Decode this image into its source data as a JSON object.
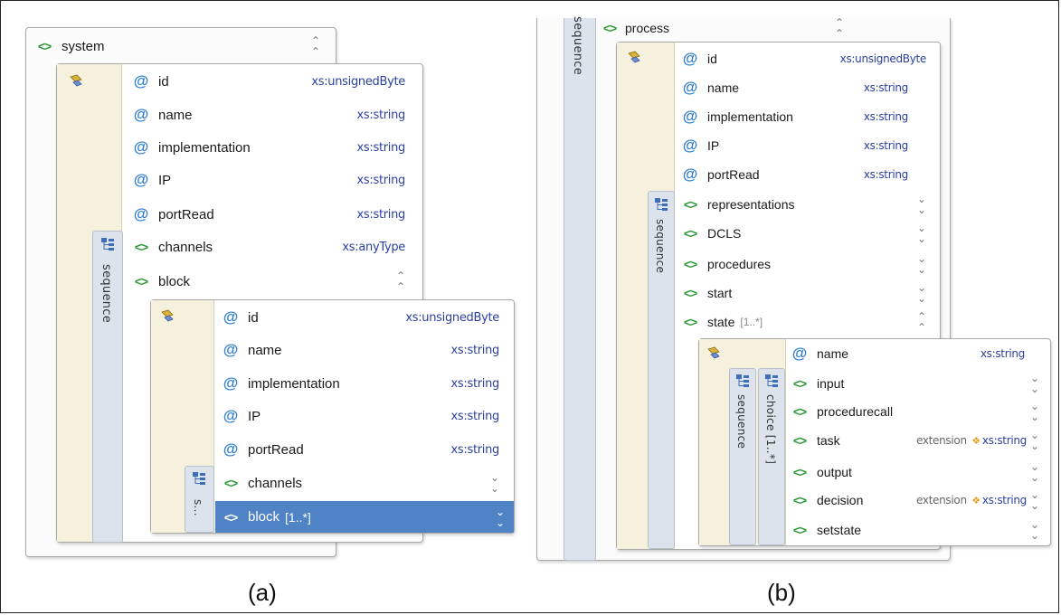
{
  "captions": {
    "a": "(a)",
    "b": "(b)"
  },
  "colors": {
    "attribute_icon": "#2f7fd6",
    "element_icon": "#2f9a3a",
    "type_text": "#2b3fa0",
    "selection": "#5083c6",
    "attributes_box": "#f5f1dd",
    "sequence_bar": "#dde3ec"
  },
  "icons": {
    "attribute": "@",
    "element": "<>",
    "collapse": "⌃⌃",
    "expand": "⌄⌄",
    "extension": "plus-diamond-icon",
    "sequence": "sequence-icon",
    "attributes": "attributes-icon"
  },
  "a": {
    "system": {
      "name": "system",
      "sequence_label": "sequence",
      "attributes": [
        {
          "name": "id",
          "type": "xs:unsignedByte"
        },
        {
          "name": "name",
          "type": "xs:string"
        },
        {
          "name": "implementation",
          "type": "xs:string"
        },
        {
          "name": "IP",
          "type": "xs:string"
        },
        {
          "name": "portRead",
          "type": "xs:string"
        }
      ],
      "elements": [
        {
          "name": "channels",
          "type": "xs:anyType"
        },
        {
          "name": "block"
        }
      ]
    },
    "block": {
      "sequence_label": "s...",
      "attributes": [
        {
          "name": "id",
          "type": "xs:unsignedByte"
        },
        {
          "name": "name",
          "type": "xs:string"
        },
        {
          "name": "implementation",
          "type": "xs:string"
        },
        {
          "name": "IP",
          "type": "xs:string"
        },
        {
          "name": "portRead",
          "type": "xs:string"
        }
      ],
      "elements": [
        {
          "name": "channels"
        },
        {
          "name": "block",
          "multiplicity": "[1..*]"
        }
      ]
    }
  },
  "b": {
    "outer_sequence_label": "sequence",
    "process": {
      "name": "process",
      "sequence_label": "sequence",
      "attributes": [
        {
          "name": "id",
          "type": "xs:unsignedByte"
        },
        {
          "name": "name",
          "type": "xs:string"
        },
        {
          "name": "implementation",
          "type": "xs:string"
        },
        {
          "name": "IP",
          "type": "xs:string"
        },
        {
          "name": "portRead",
          "type": "xs:string"
        }
      ],
      "elements": [
        {
          "name": "representations"
        },
        {
          "name": "DCLS"
        },
        {
          "name": "procedures"
        },
        {
          "name": "start"
        },
        {
          "name": "state",
          "multiplicity": "[1..*]"
        }
      ]
    },
    "state": {
      "sequence_label": "sequence",
      "choice_label": "choice  [1..*]",
      "attributes": [
        {
          "name": "name",
          "type": "xs:string"
        }
      ],
      "elements": [
        {
          "name": "input"
        },
        {
          "name": "procedurecall"
        },
        {
          "name": "task",
          "ext": "extension",
          "type": "xs:string"
        },
        {
          "name": "output"
        },
        {
          "name": "decision",
          "ext": "extension",
          "type": "xs:string"
        },
        {
          "name": "setstate"
        }
      ]
    }
  }
}
